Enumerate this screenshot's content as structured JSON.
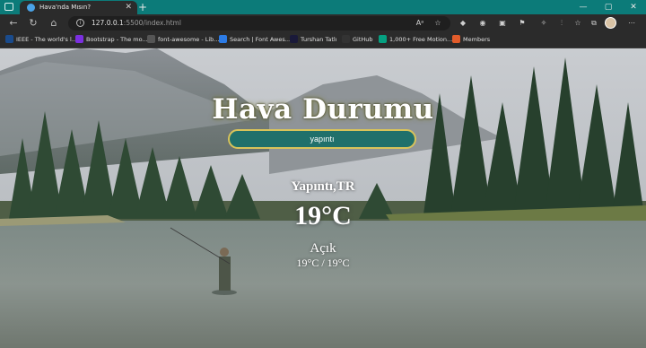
{
  "browser": {
    "tab_title": "Hava'nda Mısın?",
    "tab_close": "✕",
    "new_tab": "+",
    "url_host": "127.0.0.1",
    "url_path": ":5500/index.html",
    "window_min": "—",
    "window_max": "▢",
    "window_close": "✕",
    "accent_color": "#0c7b79"
  },
  "bookmarks": [
    {
      "label": "IEEE - The world's l...",
      "icon": "ieee-icon",
      "color": "#1a4b8c"
    },
    {
      "label": "Bootstrap - The mo...",
      "icon": "bootstrap-icon",
      "color": "#7b2fe0"
    },
    {
      "label": "font-awesome - Lib...",
      "icon": "code-icon",
      "color": "#555555"
    },
    {
      "label": "Search | Font Awes...",
      "icon": "flag-icon",
      "color": "#2c7be5"
    },
    {
      "label": "Turshan Tatlı",
      "icon": "tt-icon",
      "color": "#1a1a3a"
    },
    {
      "label": "GitHub",
      "icon": "github-icon",
      "color": "#333333"
    },
    {
      "label": "1,000+ Free Motion...",
      "icon": "px-icon",
      "color": "#05a081"
    },
    {
      "label": "Members",
      "icon": "members-icon",
      "color": "#e25c2b"
    }
  ],
  "page": {
    "heading": "Hava Durumu",
    "search_value": "yapıntı",
    "city": "Yapıntı,TR",
    "temperature": "19°C",
    "description": "Açık",
    "range": "19°C / 19°C"
  }
}
